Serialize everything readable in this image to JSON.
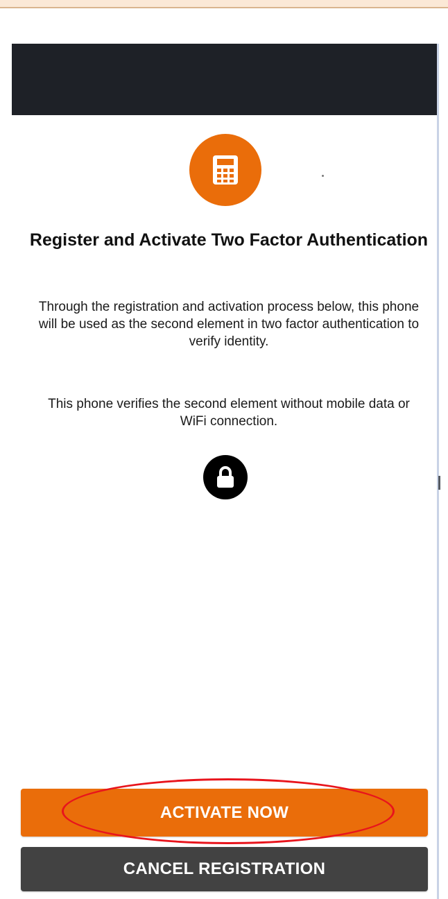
{
  "header": {
    "title": "Register and Activate Two Factor Authentication"
  },
  "body": {
    "paragraph_1": "Through the registration and activation process below, this phone will be used as the second element in two factor authentication to verify identity.",
    "paragraph_2": "This phone verifies the second element without mobile data or WiFi connection."
  },
  "icons": {
    "top": "calculator-icon",
    "middle": "lock-icon"
  },
  "buttons": {
    "activate_label": "ACTIVATE NOW",
    "cancel_label": "CANCEL REGISTRATION"
  },
  "colors": {
    "accent": "#ea6d0a",
    "app_bar": "#1e2127",
    "cancel_button": "#424242",
    "highlight": "#e8141c"
  }
}
